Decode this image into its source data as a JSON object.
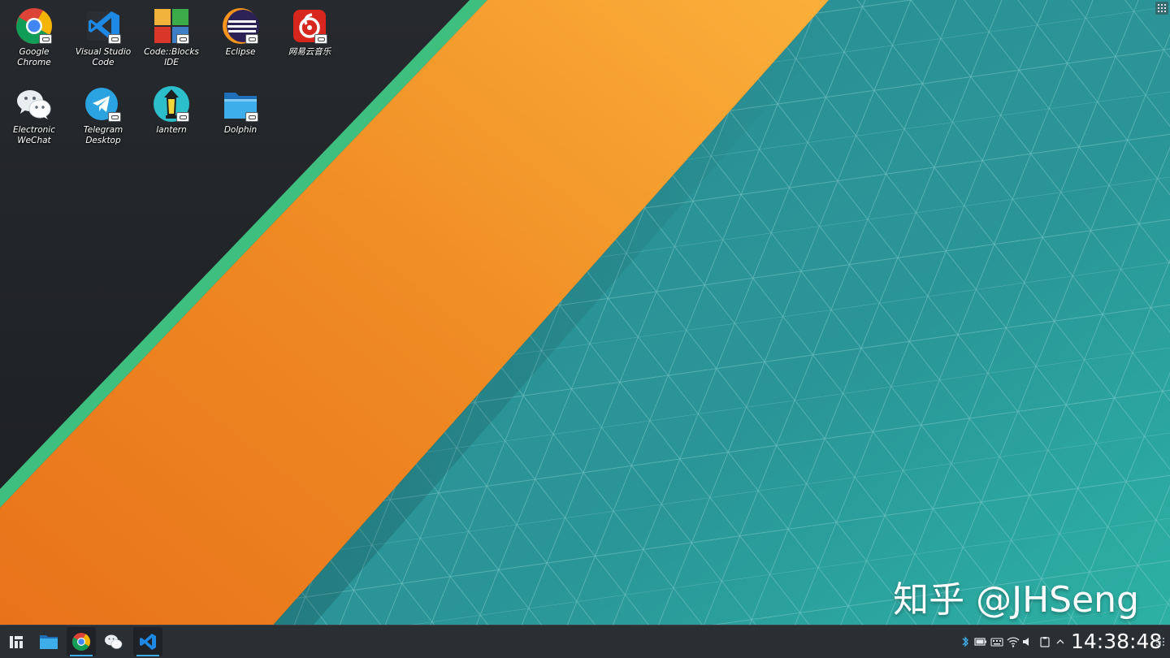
{
  "desktop": {
    "icons": [
      {
        "label": "Google Chrome",
        "icon": "chrome-icon"
      },
      {
        "label": "Visual Studio Code",
        "icon": "vscode-icon"
      },
      {
        "label": "Code::Blocks IDE",
        "icon": "codeblocks-icon"
      },
      {
        "label": "Eclipse",
        "icon": "eclipse-icon"
      },
      {
        "label": "网易云音乐",
        "icon": "netease-music-icon"
      },
      {
        "label": "Electronic WeChat",
        "icon": "wechat-icon"
      },
      {
        "label": "Telegram Desktop",
        "icon": "telegram-icon"
      },
      {
        "label": "lantern",
        "icon": "lantern-icon"
      },
      {
        "label": "Dolphin",
        "icon": "dolphin-folder-icon"
      }
    ],
    "watermark": "知乎 @JHSeng"
  },
  "taskbar": {
    "launcher_icon": "application-launcher-icon",
    "tasks": [
      {
        "name": "Dolphin",
        "icon": "dolphin-folder-icon"
      },
      {
        "name": "Google Chrome",
        "icon": "chrome-icon"
      },
      {
        "name": "Electronic WeChat",
        "icon": "wechat-icon"
      },
      {
        "name": "Visual Studio Code",
        "icon": "vscode-icon"
      }
    ],
    "tray_icons": [
      "bluetooth-icon",
      "battery-icon",
      "keyboard-icon",
      "wifi-icon",
      "volume-icon",
      "expand-tray-icon",
      "clipboard-icon"
    ],
    "clock": "14:38:48"
  },
  "colors": {
    "dark_background": "#1f2327",
    "green_stripe": "#3fbf7f",
    "orange_band": "#f0891f",
    "teal_background": "#2a9a9c",
    "taskbar": "#2a2f34",
    "accent": "#3daee9"
  }
}
